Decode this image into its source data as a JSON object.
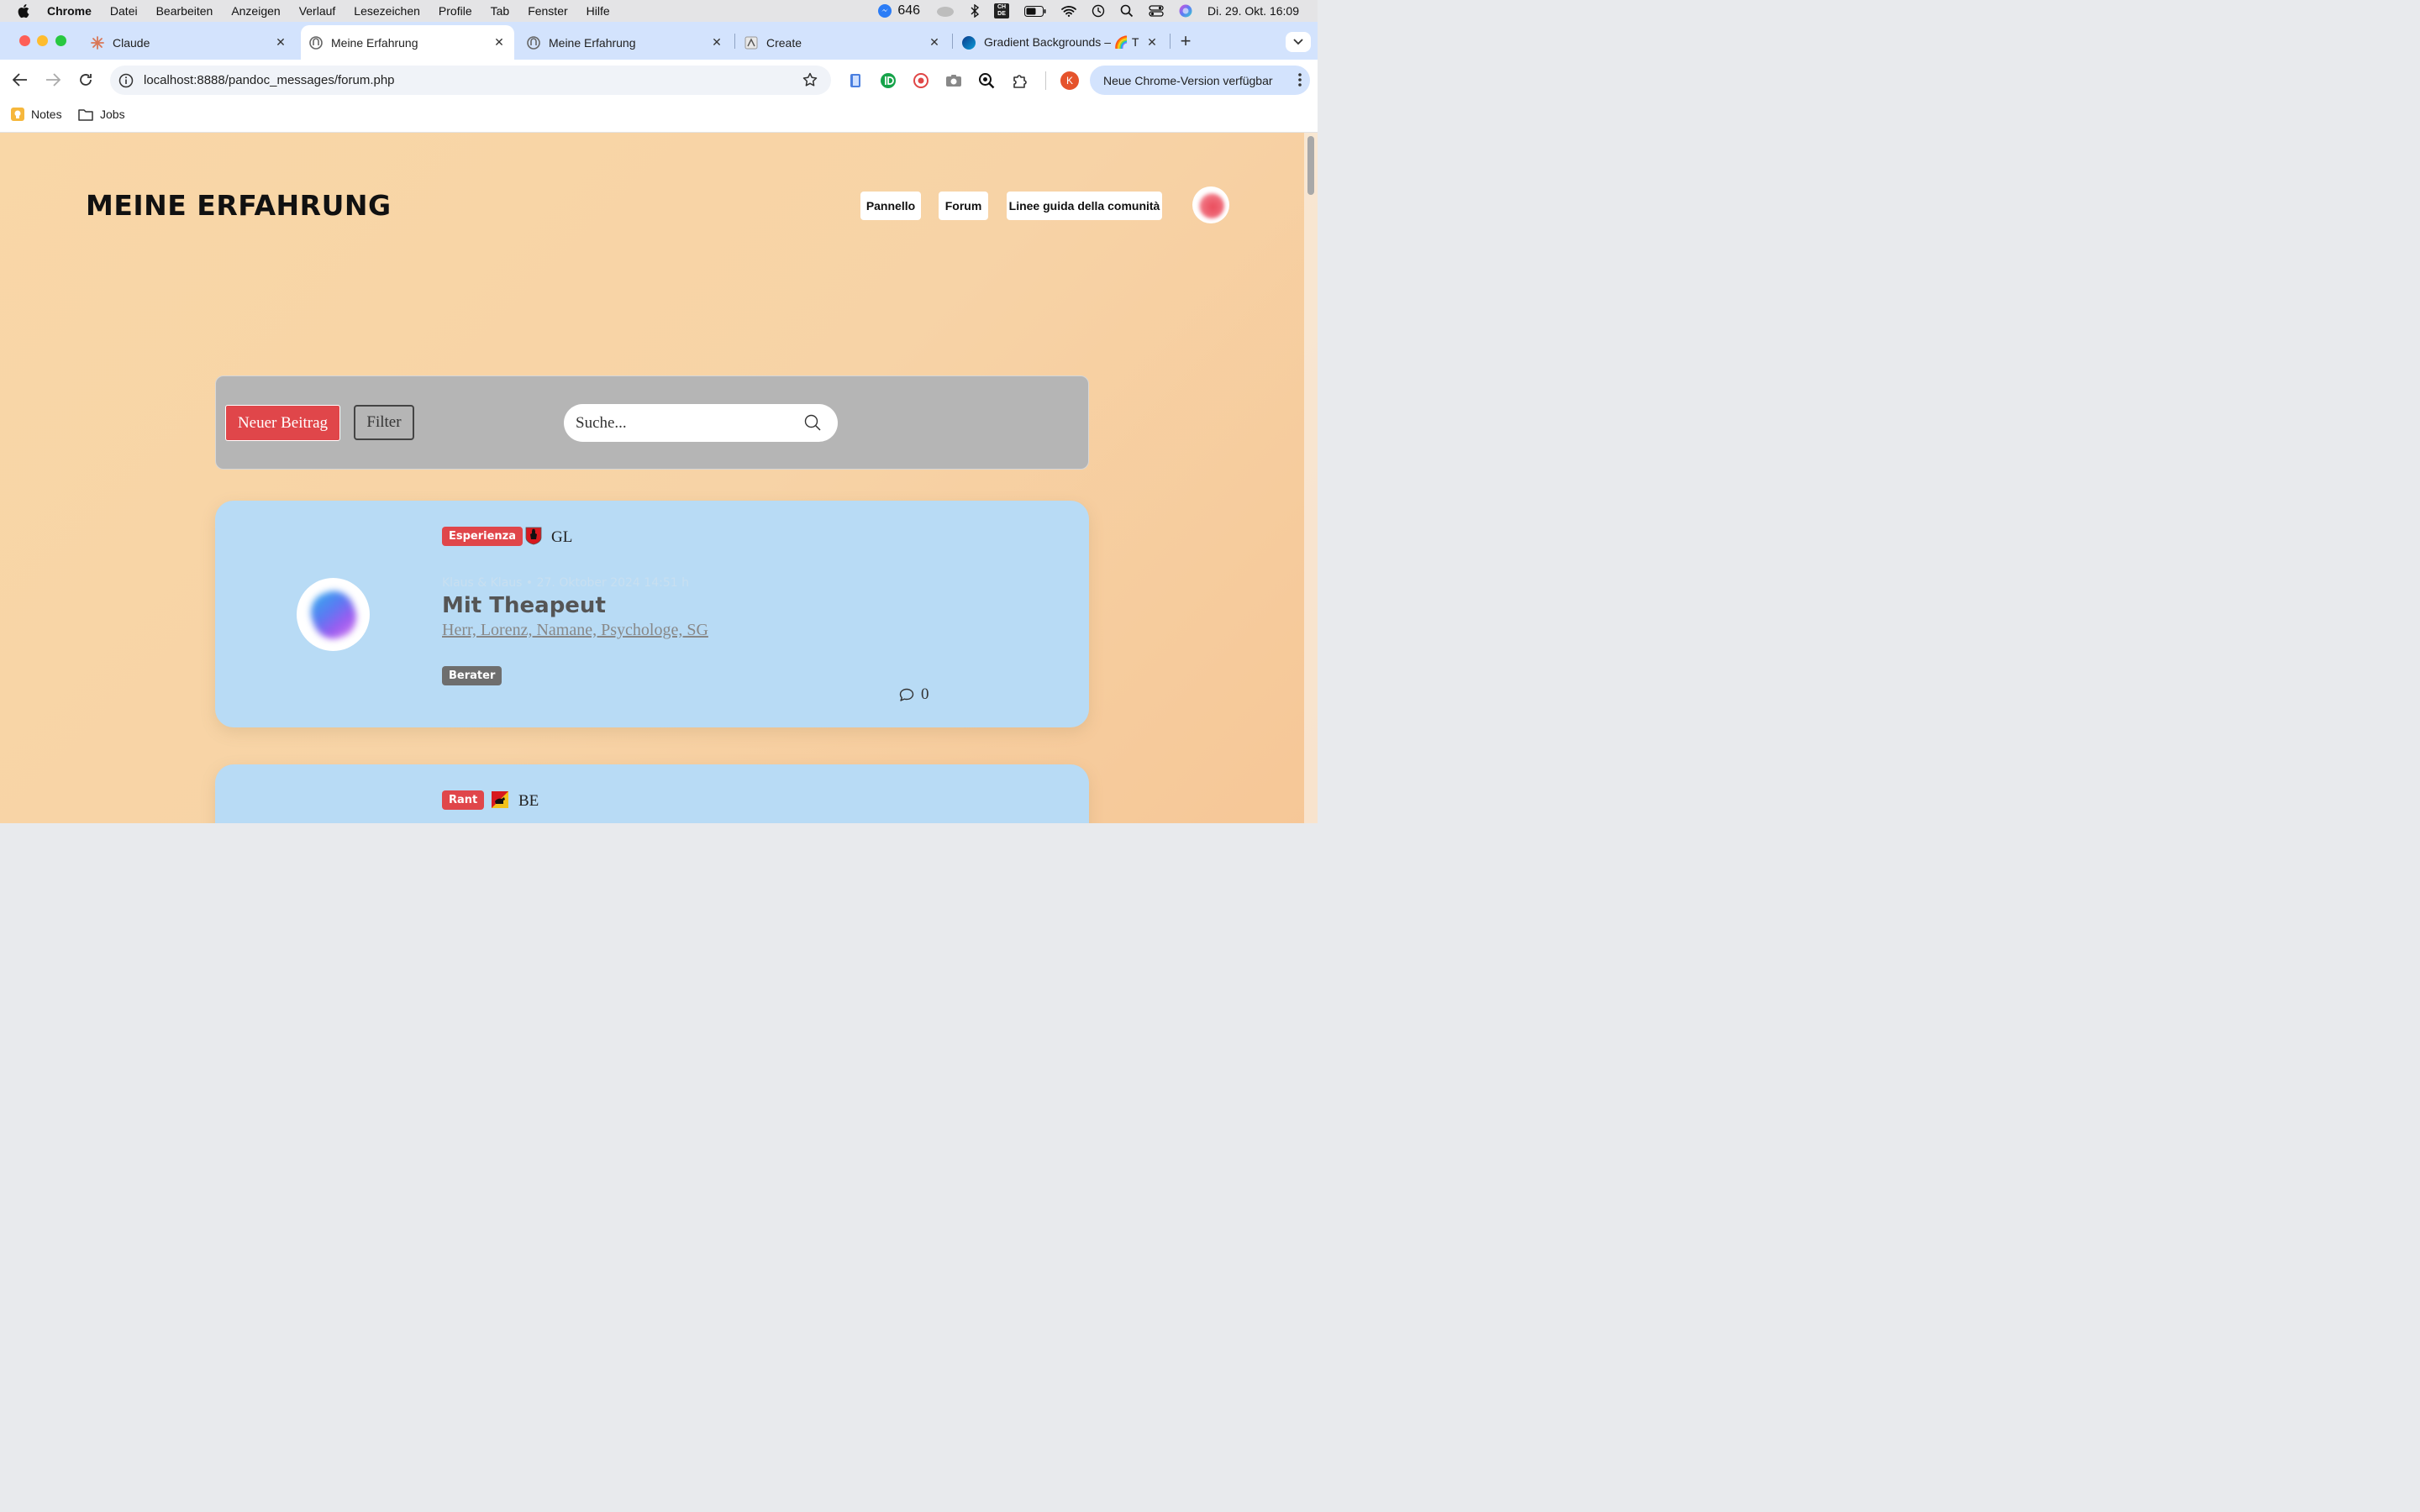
{
  "menubar": {
    "app": "Chrome",
    "items": [
      "Datei",
      "Bearbeiten",
      "Anzeigen",
      "Verlauf",
      "Lesezeichen",
      "Profile",
      "Tab",
      "Fenster",
      "Hilfe"
    ],
    "notification_count": "646",
    "keyboard_layout": "CH DE",
    "datetime": "Di. 29. Okt. 16:09"
  },
  "tabs": [
    {
      "title": "Claude",
      "icon": "claude-icon"
    },
    {
      "title": "Meine Erfahrung",
      "icon": "site-icon",
      "active": true
    },
    {
      "title": "Meine Erfahrung",
      "icon": "site-icon"
    },
    {
      "title": "Create",
      "icon": "create-icon"
    },
    {
      "title": "Gradient Backgrounds – 🌈 T",
      "icon": "globe-icon"
    }
  ],
  "toolbar": {
    "url": "localhost:8888/pandoc_messages/forum.php",
    "profile_initial": "K",
    "update_label": "Neue Chrome-Version verfügbar"
  },
  "bookmarks": [
    {
      "label": "Notes",
      "icon": "notes-icon"
    },
    {
      "label": "Jobs",
      "icon": "folder-icon"
    }
  ],
  "site": {
    "title": "MEINE ERFAHRUNG",
    "nav": [
      "Pannello",
      "Forum",
      "Linee guida della comunità"
    ]
  },
  "controls": {
    "new_post": "Neuer Beitrag",
    "filter": "Filter",
    "search_placeholder": "Suche..."
  },
  "posts": [
    {
      "category": "Esperienza",
      "canton": "GL",
      "meta": "Klaus & Klaus • 27. Oktober 2024 14:51 h",
      "title": "Mit Theapeut",
      "link": "Herr, Lorenz, Namane, Psychologe, SG",
      "tag": "Berater",
      "comments": "0"
    },
    {
      "category": "Rant",
      "canton": "BE"
    }
  ],
  "colors": {
    "accent_red": "#e0464a",
    "card_blue": "#b8dbf5",
    "page_gradient_start": "#f9d7a7",
    "page_gradient_end": "#f6c797"
  }
}
